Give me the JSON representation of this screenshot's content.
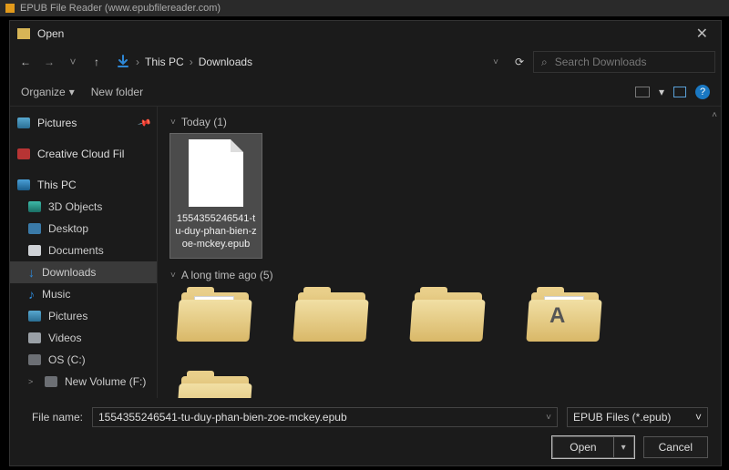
{
  "app": {
    "title": "EPUB File Reader (www.epubfilereader.com)"
  },
  "dialog": {
    "title": "Open",
    "close_glyph": "✕"
  },
  "nav": {
    "back_glyph": "←",
    "forward_glyph": "→",
    "recent_glyph": "˅",
    "up_glyph": "↑",
    "dropdown_glyph": "˅",
    "refresh_glyph": "⟳"
  },
  "breadcrumb": {
    "items": [
      "This PC",
      "Downloads"
    ],
    "sep": "›"
  },
  "search": {
    "placeholder": "Search Downloads",
    "icon_glyph": "⌕"
  },
  "toolbar": {
    "organize": "Organize",
    "organize_caret": "▾",
    "newfolder": "New folder",
    "view_caret": "▾",
    "help_glyph": "?"
  },
  "sidebar": {
    "pictures": "Pictures",
    "pin_glyph": "📌",
    "cc": "Creative Cloud Fil",
    "thispc": "This PC",
    "items": [
      {
        "label": "3D Objects"
      },
      {
        "label": "Desktop"
      },
      {
        "label": "Documents"
      },
      {
        "label": "Downloads"
      },
      {
        "label": "Music"
      },
      {
        "label": "Pictures"
      },
      {
        "label": "Videos"
      },
      {
        "label": "OS (C:)"
      },
      {
        "label": "New Volume (F:)"
      }
    ],
    "expand_glyph": "˅",
    "collapse_glyph": "˃",
    "dl_glyph": "↓",
    "music_glyph": "♪"
  },
  "main": {
    "scroll_up_glyph": "˄",
    "groups": [
      {
        "label": "Today (1)"
      },
      {
        "label": "A long time ago (5)"
      }
    ],
    "file": {
      "name": "1554355246541-tu-duy-phan-bien-zoe-mckey.epub"
    }
  },
  "footer": {
    "filename_label": "File name:",
    "filename_value": "1554355246541-tu-duy-phan-bien-zoe-mckey.epub",
    "filter": "EPUB Files (*.epub)",
    "dd_glyph": "˅",
    "open": "Open",
    "open_caret": "▾",
    "cancel": "Cancel"
  }
}
